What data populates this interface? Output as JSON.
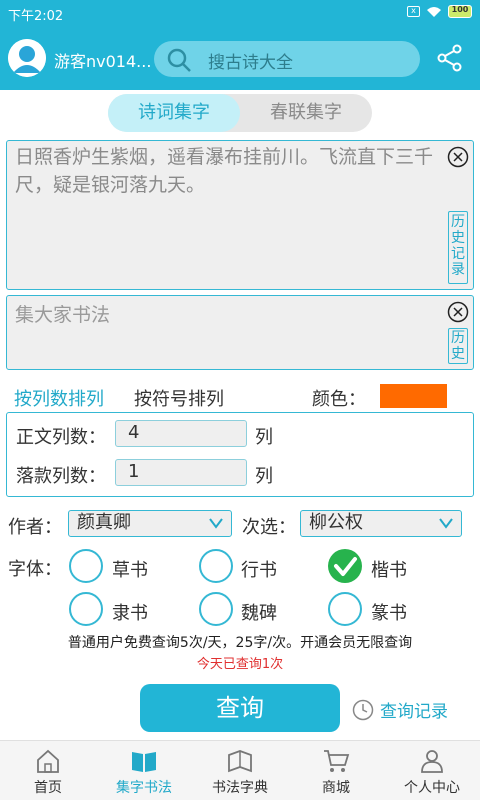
{
  "status_bar": {
    "time": "下午2:02",
    "battery": "100"
  },
  "header": {
    "username": "游客nv014...",
    "search_placeholder": "搜古诗大全"
  },
  "tabs": [
    {
      "label": "诗词集字",
      "active": true
    },
    {
      "label": "春联集字",
      "active": false
    }
  ],
  "poem": {
    "text": "日照香炉生紫烟，遥看瀑布挂前川。飞流直下三千尺，疑是银河落九天。",
    "history_label": "历史记录"
  },
  "signature": {
    "placeholder": "集大家书法",
    "history_label": "历史"
  },
  "sort": {
    "by_column": "按列数排列",
    "by_symbol": "按符号排列",
    "color_label": "颜色：",
    "color": "#ff6a00"
  },
  "columns": {
    "body_label": "正文列数：",
    "body_value": "4",
    "sign_label": "落款列数：",
    "sign_value": "1",
    "unit": "列"
  },
  "author": {
    "label": "作者：",
    "value": "颜真卿",
    "secondary_label": "次选：",
    "secondary_value": "柳公权"
  },
  "font": {
    "label": "字体：",
    "options": [
      {
        "label": "草书",
        "checked": false
      },
      {
        "label": "行书",
        "checked": false
      },
      {
        "label": "楷书",
        "checked": true
      },
      {
        "label": "隶书",
        "checked": false
      },
      {
        "label": "魏碑",
        "checked": false
      },
      {
        "label": "篆书",
        "checked": false
      }
    ]
  },
  "notice": "普通用户免费查询5次/天，25字/次。开通会员无限查询",
  "count_note": "今天已查询1次",
  "query_button": "查询",
  "history_link": "查询记录",
  "nav": [
    {
      "label": "首页",
      "icon": "home-icon",
      "active": false
    },
    {
      "label": "集字书法",
      "icon": "book-icon",
      "active": true
    },
    {
      "label": "书法字典",
      "icon": "dictionary-icon",
      "active": false
    },
    {
      "label": "商城",
      "icon": "cart-icon",
      "active": false
    },
    {
      "label": "个人中心",
      "icon": "person-icon",
      "active": false
    }
  ],
  "colors": {
    "primary": "#22b5d6",
    "check_green": "#27b34d",
    "alert_red": "#e03030"
  }
}
